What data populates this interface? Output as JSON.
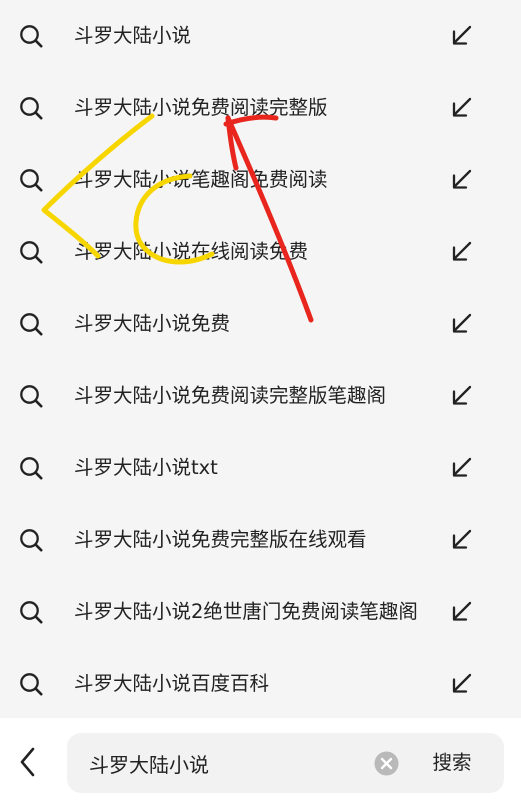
{
  "suggestions": [
    {
      "text": "斗罗大陆小说"
    },
    {
      "text": "斗罗大陆小说免费阅读完整版"
    },
    {
      "text": "斗罗大陆小说笔趣阁免费阅读"
    },
    {
      "text": "斗罗大陆小说在线阅读免费"
    },
    {
      "text": "斗罗大陆小说免费"
    },
    {
      "text": "斗罗大陆小说免费阅读完整版笔趣阁"
    },
    {
      "text": "斗罗大陆小说txt"
    },
    {
      "text": "斗罗大陆小说免费完整版在线观看"
    },
    {
      "text": "斗罗大陆小说2绝世唐门免费阅读笔趣阁"
    },
    {
      "text": "斗罗大陆小说百度百科"
    }
  ],
  "search": {
    "value": "斗罗大陆小说",
    "submit_label": "搜索"
  },
  "icons": {
    "row_leading": "search-icon",
    "row_trailing": "fill-query-arrow-icon",
    "back": "back-chevron-icon",
    "clear": "clear-icon"
  },
  "colors": {
    "annotation_red": "#e8261e",
    "annotation_yellow": "#f7d600",
    "icon": "#222222",
    "clear_icon": "#b9b9b9"
  }
}
